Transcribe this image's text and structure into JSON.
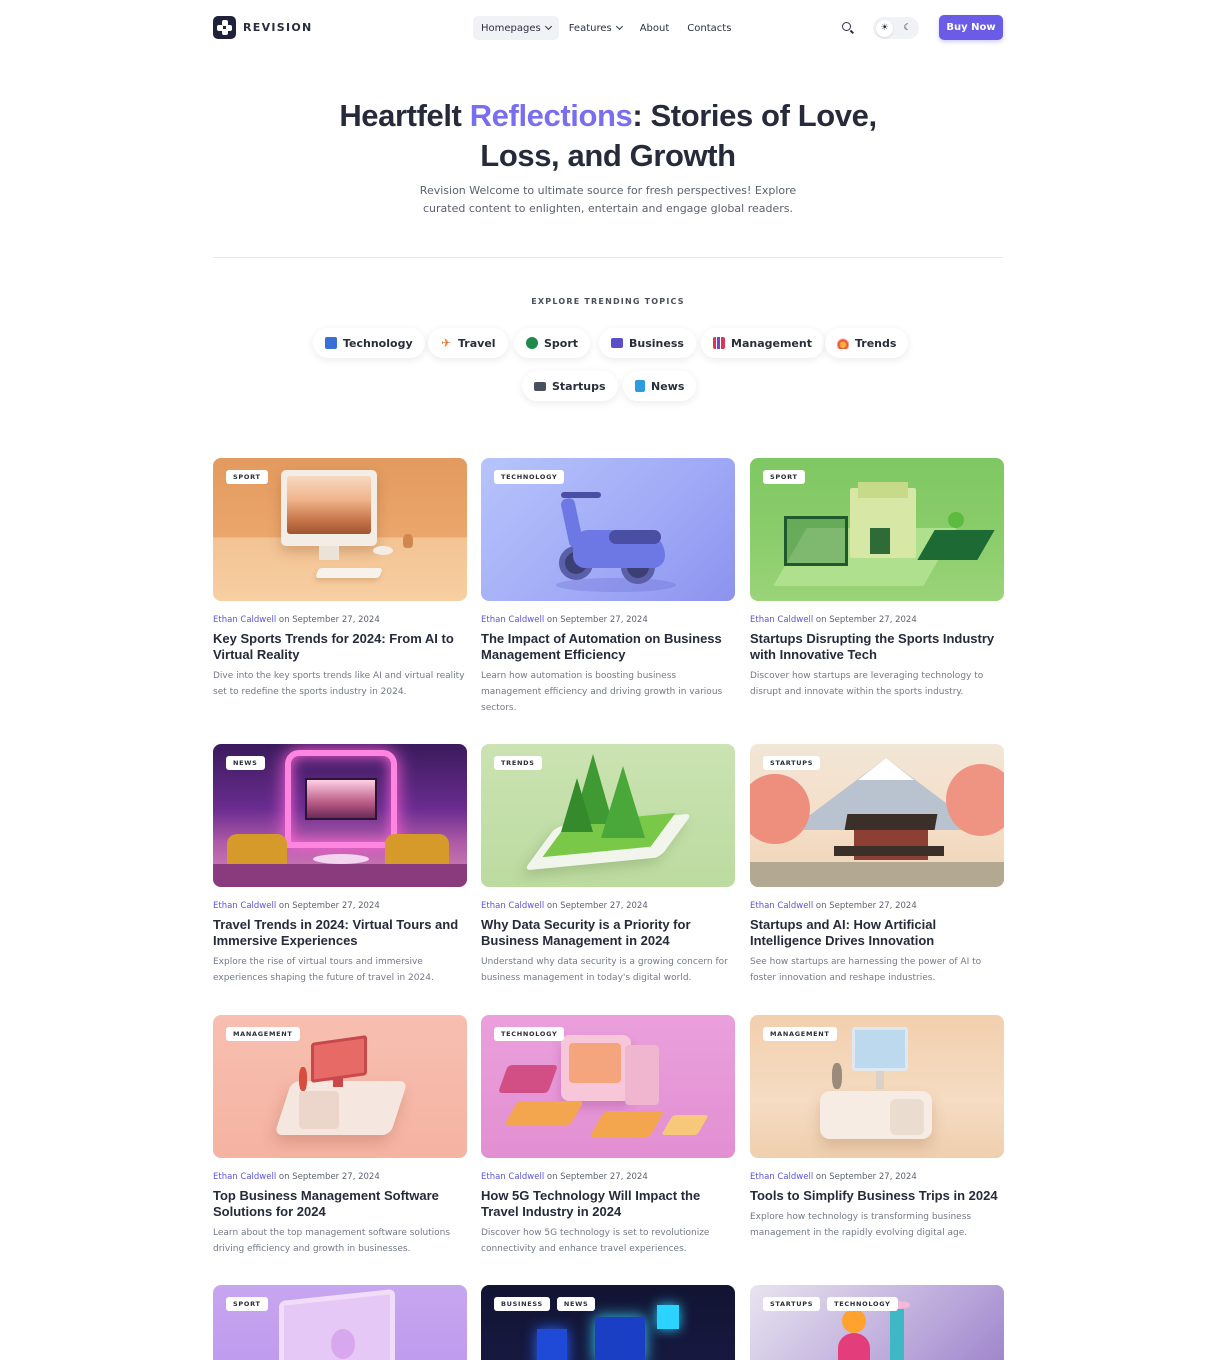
{
  "header": {
    "brand": "REVISION",
    "nav": [
      {
        "label": "Homepages",
        "dropdown": true,
        "active": true
      },
      {
        "label": "Features",
        "dropdown": true,
        "active": false
      },
      {
        "label": "About",
        "dropdown": false,
        "active": false
      },
      {
        "label": "Contacts",
        "dropdown": false,
        "active": false
      }
    ],
    "search_icon": "search-icon",
    "theme_light_icon": "☀",
    "theme_dark_icon": "☾",
    "buy_label": "Buy Now",
    "accent_color": "#6b5ce7"
  },
  "hero": {
    "title_part1": "Heartfelt ",
    "title_accent": "Reflections",
    "title_part2": ": Stories of Love, Loss, and Growth",
    "subtitle": "Revision Welcome to ultimate source for fresh perspectives! Explore curated content to enlighten, entertain and engage global readers."
  },
  "topics": {
    "heading": "EXPLORE TRENDING TOPICS",
    "items": [
      {
        "label": "Technology",
        "icon": "laptop-icon"
      },
      {
        "label": "Travel",
        "icon": "airplane-icon"
      },
      {
        "label": "Sport",
        "icon": "ball-icon"
      },
      {
        "label": "Business",
        "icon": "briefcase-icon"
      },
      {
        "label": "Management",
        "icon": "bar-chart-icon"
      },
      {
        "label": "Trends",
        "icon": "fire-icon"
      },
      {
        "label": "Startups",
        "icon": "presentation-icon"
      },
      {
        "label": "News",
        "icon": "document-icon"
      }
    ]
  },
  "posts": [
    {
      "tags": [
        "SPORT"
      ],
      "author": "Ethan Caldwell",
      "date": "on September 27, 2024",
      "title": "Key Sports Trends for 2024: From AI to Virtual Reality",
      "excerpt": "Dive into the key sports trends like AI and virtual reality set to redefine the sports industry in 2024."
    },
    {
      "tags": [
        "TECHNOLOGY"
      ],
      "author": "Ethan Caldwell",
      "date": "on September 27, 2024",
      "title": "The Impact of Automation on Business Management Efficiency",
      "excerpt": "Learn how automation is boosting business management efficiency and driving growth in various sectors."
    },
    {
      "tags": [
        "SPORT"
      ],
      "author": "Ethan Caldwell",
      "date": "on September 27, 2024",
      "title": "Startups Disrupting the Sports Industry with Innovative Tech",
      "excerpt": "Discover how startups are leveraging technology to disrupt and innovate within the sports industry."
    },
    {
      "tags": [
        "NEWS"
      ],
      "author": "Ethan Caldwell",
      "date": "on September 27, 2024",
      "title": "Travel Trends in 2024: Virtual Tours and Immersive Experiences",
      "excerpt": "Explore the rise of virtual tours and immersive experiences shaping the future of travel in 2024."
    },
    {
      "tags": [
        "TRENDS"
      ],
      "author": "Ethan Caldwell",
      "date": "on September 27, 2024",
      "title": "Why Data Security is a Priority for Business Management in 2024",
      "excerpt": "Understand why data security is a growing concern for business management in today's digital world."
    },
    {
      "tags": [
        "STARTUPS"
      ],
      "author": "Ethan Caldwell",
      "date": "on September 27, 2024",
      "title": "Startups and AI: How Artificial Intelligence Drives Innovation",
      "excerpt": "See how startups are harnessing the power of AI to foster innovation and reshape industries."
    },
    {
      "tags": [
        "MANAGEMENT"
      ],
      "author": "Ethan Caldwell",
      "date": "on September 27, 2024",
      "title": "Top Business Management Software Solutions for 2024",
      "excerpt": "Learn about the top management software solutions driving efficiency and growth in businesses."
    },
    {
      "tags": [
        "TECHNOLOGY"
      ],
      "author": "Ethan Caldwell",
      "date": "on September 27, 2024",
      "title": "How 5G Technology Will Impact the Travel Industry in 2024",
      "excerpt": "Discover how 5G technology is set to revolutionize connectivity and enhance travel experiences."
    },
    {
      "tags": [
        "MANAGEMENT"
      ],
      "author": "Ethan Caldwell",
      "date": "on September 27, 2024",
      "title": "Tools to Simplify Business Trips in 2024",
      "excerpt": "Explore how technology is transforming business management in the rapidly evolving digital age."
    },
    {
      "tags": [
        "SPORT"
      ]
    },
    {
      "tags": [
        "BUSINESS",
        "NEWS"
      ]
    },
    {
      "tags": [
        "STARTUPS",
        "TECHNOLOGY"
      ]
    }
  ]
}
